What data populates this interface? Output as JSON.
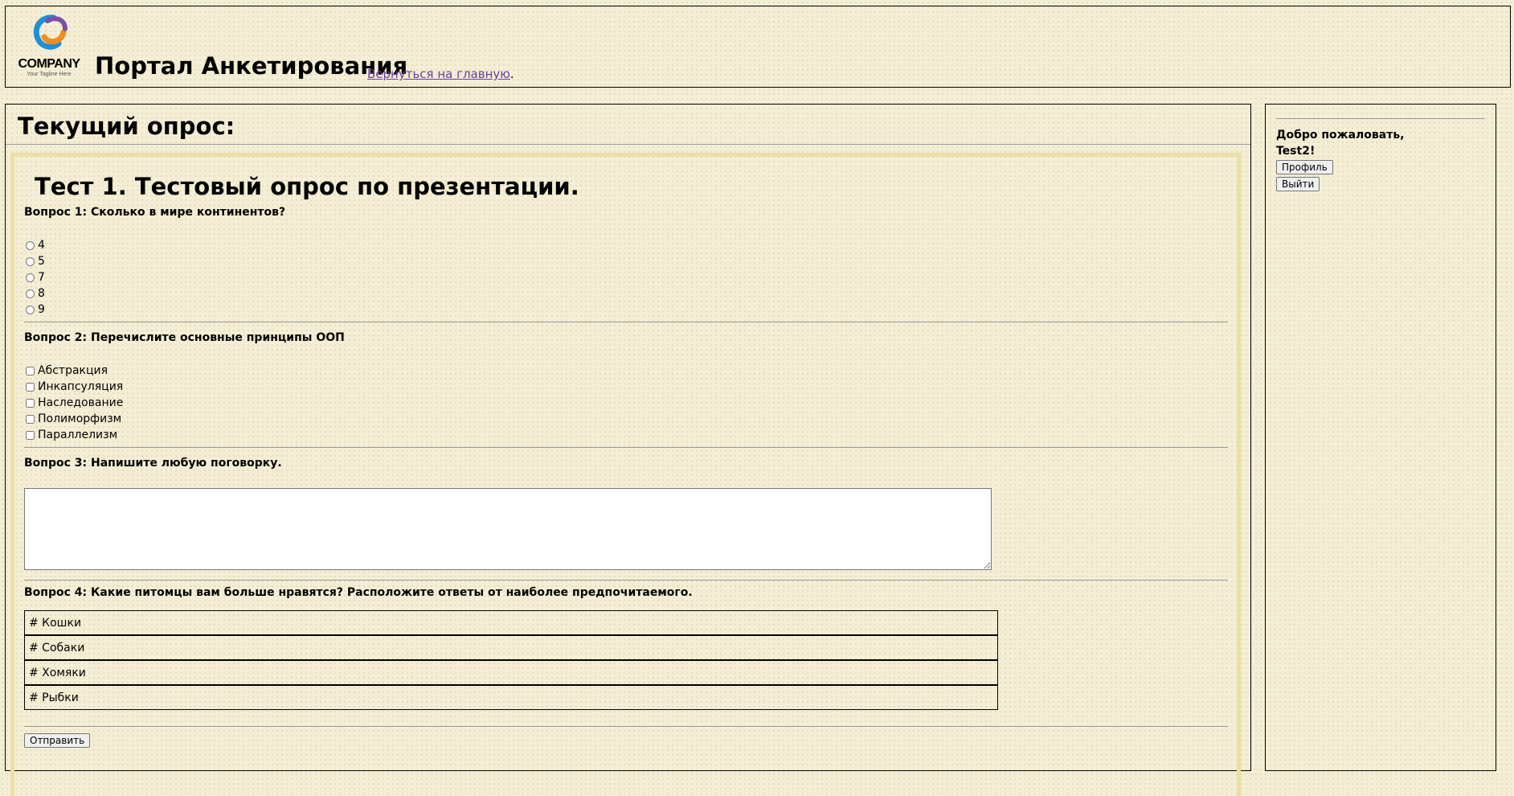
{
  "header": {
    "logo_text": "COMPANY",
    "logo_tagline": "Your Tagline Here",
    "site_title": "Портал Анкетирования",
    "home_link": "Вернуться на главную",
    "home_link_suffix": "."
  },
  "main": {
    "heading": "Текущий опрос:",
    "survey_title": "Тест 1. Тестовый опрос по презентации.",
    "questions": [
      {
        "title": "Вопрос 1: Сколько в мире континентов?",
        "type": "radio",
        "options": [
          "4",
          "5",
          "7",
          "8",
          "9"
        ]
      },
      {
        "title": "Вопрос 2: Перечислите основные принципы ООП",
        "type": "checkbox",
        "options": [
          "Абстракция",
          "Инкапсуляция",
          "Наследование",
          "Полиморфизм",
          "Параллелизм"
        ]
      },
      {
        "title": "Вопрос 3: Напишите любую поговорку.",
        "type": "text",
        "value": ""
      },
      {
        "title": "Вопрос 4: Какие питомцы вам больше нравятся? Расположите ответы от наиболее предпочитаемого.",
        "type": "rank",
        "options": [
          "# Кошки",
          "# Собаки",
          "# Хомяки",
          "# Рыбки"
        ]
      }
    ],
    "submit_label": "Отправить"
  },
  "sidebar": {
    "welcome_line1": "Добро пожаловать,",
    "welcome_line2": "Test2!",
    "profile_label": "Профиль",
    "logout_label": "Выйти"
  },
  "colors": {
    "background": "#f4eed6",
    "survey_border": "#eadfa8",
    "link": "#6b3fa0",
    "logo_blue": "#1f8fd6",
    "logo_orange": "#f28c1c",
    "logo_purple": "#7b4fa6"
  }
}
